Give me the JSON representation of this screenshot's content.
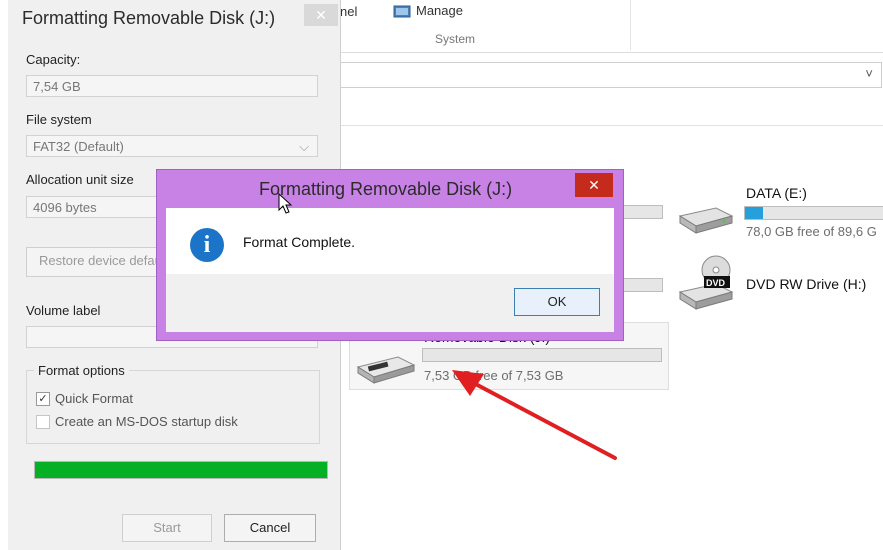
{
  "explorer": {
    "ribbon": {
      "panel_fragment": "nel",
      "manage_label": "Manage",
      "group_label": "System"
    },
    "address_dropdown": "˅",
    "drives": [
      {
        "title": "DATA (E:)",
        "free": "78,0 GB free of 89,6 G",
        "usage": 0.13
      },
      {
        "title": "DVD RW Drive (H:)",
        "icon_label": "DVD"
      },
      {
        "title": "Removable Disk (J:)",
        "free": "7,53 GB free of 7,53 GB",
        "usage": 0.0
      }
    ],
    "colors": {
      "drive_bar_fill": "#26a0da",
      "annotation_arrow": "#e02020"
    }
  },
  "format_dialog": {
    "title": "Formatting Removable Disk (J:)",
    "capacity_label": "Capacity:",
    "capacity_value": "7,54 GB",
    "filesystem_label": "File system",
    "filesystem_value": "FAT32 (Default)",
    "allocation_label": "Allocation unit size",
    "allocation_value": "4096 bytes",
    "restore_button": "Restore device defaults",
    "volume_label": "Volume label",
    "volume_value": "",
    "format_options_label": "Format options",
    "quick_format_label": "Quick Format",
    "quick_format_checked": true,
    "msdos_label": "Create an MS-DOS startup disk",
    "msdos_checked": false,
    "progress": 1.0,
    "start_button": "Start",
    "cancel_button": "Cancel",
    "colors": {
      "progress": "#06b025"
    }
  },
  "message_box": {
    "title": "Formatting Removable Disk (J:)",
    "message": "Format Complete.",
    "ok_button": "OK",
    "icon": "info-icon",
    "colors": {
      "frame": "#c882e6",
      "close": "#c42b1c"
    }
  }
}
